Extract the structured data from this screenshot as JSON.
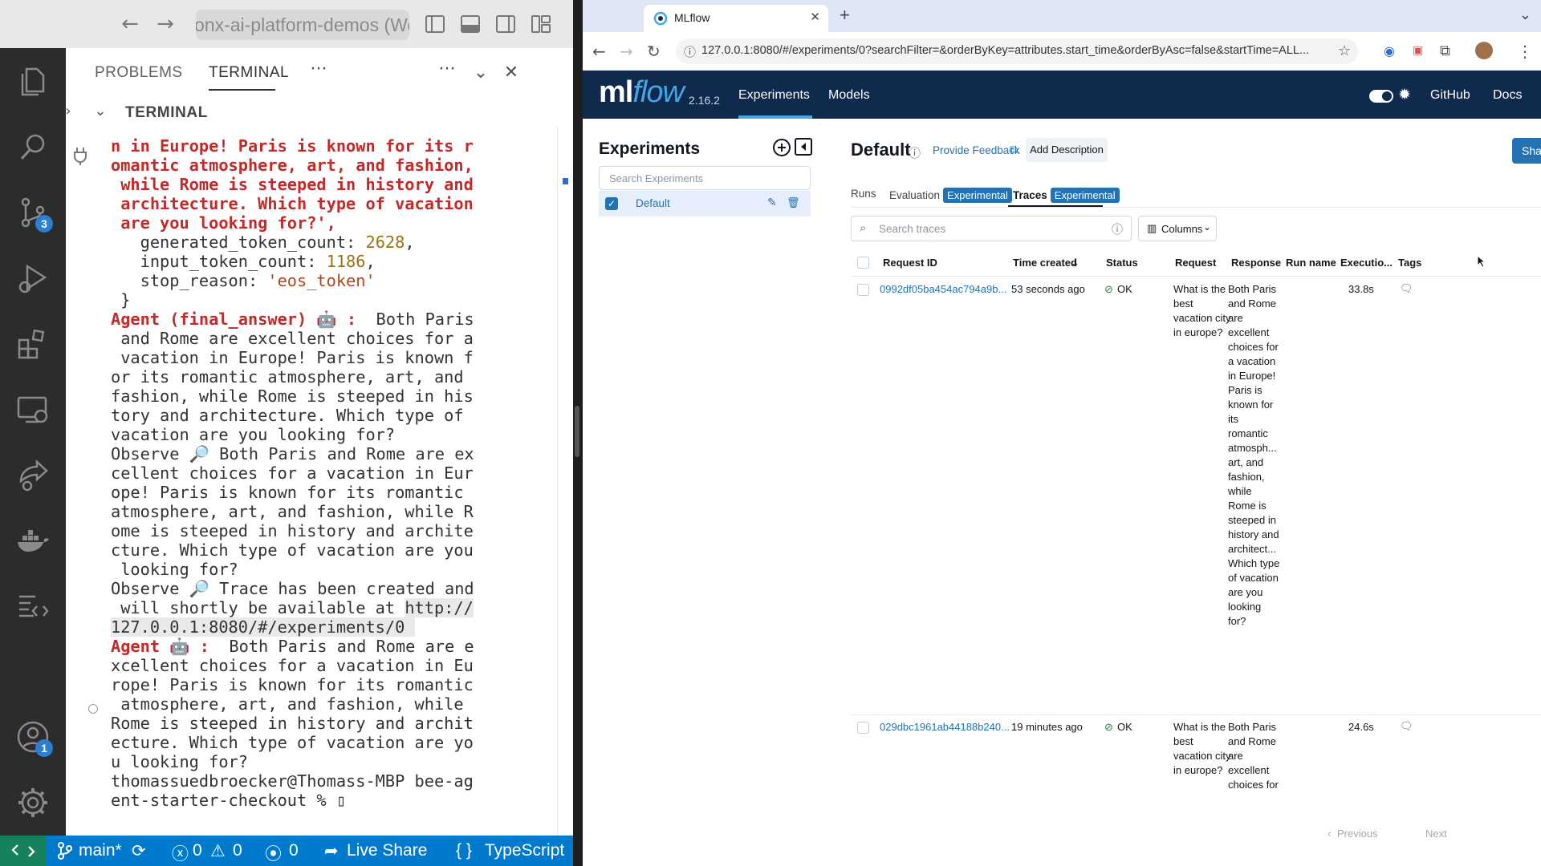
{
  "vscode": {
    "command_center": "onx-ai-platform-demos (Wo",
    "activity_badges": {
      "source_control": "3",
      "accounts": "1"
    },
    "panel_tabs": [
      "PROBLEMS",
      "TERMINAL"
    ],
    "panel_more": "···",
    "terminal_header": "TERMINAL",
    "terminal_lines": [
      [
        {
          "t": "n in Europe! Paris is known for its r",
          "c": "red"
        }
      ],
      [
        {
          "t": "omantic atmosphere, art, and fashion,",
          "c": "red"
        }
      ],
      [
        {
          "t": " while Rome is steeped in history and",
          "c": "red"
        }
      ],
      [
        {
          "t": " architecture. Which type of vacation",
          "c": "red"
        }
      ],
      [
        {
          "t": " are you looking for?',",
          "c": "red"
        }
      ],
      [
        {
          "t": "   generated_token_count: ",
          "c": ""
        },
        {
          "t": "2628",
          "c": "num"
        },
        {
          "t": ",",
          "c": ""
        }
      ],
      [
        {
          "t": "   input_token_count: ",
          "c": ""
        },
        {
          "t": "1186",
          "c": "num"
        },
        {
          "t": ",",
          "c": ""
        }
      ],
      [
        {
          "t": "   stop_reason: ",
          "c": ""
        },
        {
          "t": "'eos_token'",
          "c": "str"
        }
      ],
      [
        {
          "t": " }",
          "c": ""
        }
      ],
      [
        {
          "t": "Agent (final_answer) 🤖 :",
          "c": "red"
        },
        {
          "t": "  Both Paris",
          "c": ""
        }
      ],
      [
        {
          "t": " and Rome are excellent choices for a",
          "c": ""
        }
      ],
      [
        {
          "t": " vacation in Europe! Paris is known f",
          "c": ""
        }
      ],
      [
        {
          "t": "or its romantic atmosphere, art, and",
          "c": ""
        }
      ],
      [
        {
          "t": "fashion, while Rome is steeped in his",
          "c": ""
        }
      ],
      [
        {
          "t": "tory and architecture. Which type of",
          "c": ""
        }
      ],
      [
        {
          "t": "vacation are you looking for?",
          "c": ""
        }
      ],
      [
        {
          "t": "Observe 🔎 Both Paris and Rome are ex",
          "c": ""
        }
      ],
      [
        {
          "t": "cellent choices for a vacation in Eur",
          "c": ""
        }
      ],
      [
        {
          "t": "ope! Paris is known for its romantic",
          "c": ""
        }
      ],
      [
        {
          "t": "atmosphere, art, and fashion, while R",
          "c": ""
        }
      ],
      [
        {
          "t": "ome is steeped in history and archite",
          "c": ""
        }
      ],
      [
        {
          "t": "cture. Which type of vacation are you",
          "c": ""
        }
      ],
      [
        {
          "t": " looking for?",
          "c": ""
        }
      ],
      [
        {
          "t": "Observe 🔎 Trace has been created and",
          "c": ""
        }
      ],
      [
        {
          "t": " will shortly be available at ",
          "c": ""
        },
        {
          "t": "http://",
          "c": "hl"
        }
      ],
      [
        {
          "t": "127.0.0.1:8080/#/experiments/0 ",
          "c": "hl"
        }
      ],
      [
        {
          "t": "Agent 🤖 :",
          "c": "red"
        },
        {
          "t": "  Both Paris and Rome are e",
          "c": ""
        }
      ],
      [
        {
          "t": "xcellent choices for a vacation in Eu",
          "c": ""
        }
      ],
      [
        {
          "t": "rope! Paris is known for its romantic",
          "c": ""
        }
      ],
      [
        {
          "t": " atmosphere, art, and fashion, while",
          "c": ""
        }
      ],
      [
        {
          "t": "Rome is steeped in history and archit",
          "c": ""
        }
      ],
      [
        {
          "t": "ecture. Which type of vacation are yo",
          "c": ""
        }
      ],
      [
        {
          "t": "u looking for?",
          "c": ""
        }
      ],
      [
        {
          "t": "thomassuedbroecker@Thomass-MBP bee-ag",
          "c": ""
        }
      ],
      [
        {
          "t": "ent-starter-checkout % ▯",
          "c": ""
        }
      ]
    ],
    "status": {
      "branch": "main*",
      "errors": "0",
      "warnings": "0",
      "ports": "0",
      "live_share": "Live Share",
      "language": "TypeScript"
    }
  },
  "browser": {
    "tab_title": "MLflow",
    "url": "127.0.0.1:8080/#/experiments/0?searchFilter=&orderByKey=attributes.start_time&orderByAsc=false&startTime=ALL..."
  },
  "mlflow": {
    "logo_ml": "ml",
    "logo_flow": "flow",
    "version": "2.16.2",
    "nav": {
      "experiments": "Experiments",
      "models": "Models",
      "github": "GitHub",
      "docs": "Docs"
    },
    "sidebar": {
      "title": "Experiments",
      "search_placeholder": "Search Experiments",
      "experiment": "Default"
    },
    "main": {
      "title": "Default",
      "feedback": "Provide Feedback",
      "add_description": "Add Description",
      "share": "Sha",
      "tabs": {
        "runs": "Runs",
        "evaluation": "Evaluation",
        "traces": "Traces",
        "badge": "Experimental"
      },
      "search_placeholder": "Search traces",
      "columns_label": "Columns",
      "headers": [
        "Request ID",
        "Time created",
        "Status",
        "Request",
        "Response",
        "Run name",
        "Executio...",
        "Tags"
      ],
      "rows": [
        {
          "id": "0992df05ba454ac794a9b...",
          "time": "53 seconds ago",
          "status": "OK",
          "request": "What is the best vacation city in europe?",
          "response": "Both Paris and Rome are excellent choices for a vacation in Europe! Paris is known for its romantic atmosph... art, and fashion, while Rome is steeped in history and architect... Which type of vacation are you looking for?",
          "exec": "33.8s"
        },
        {
          "id": "029dbc1961ab44188b240...",
          "time": "19 minutes ago",
          "status": "OK",
          "request": "What is the best vacation city in europe?",
          "response": "Both Paris and Rome are excellent choices for",
          "exec": "24.6s"
        }
      ],
      "pager": {
        "previous": "Previous",
        "next": "Next"
      }
    }
  },
  "colors": {
    "accent": "#2272b4",
    "mlflow_header": "#0f2a4d",
    "vscode_status": "#007acc",
    "terminal_red": "#c22a2a"
  }
}
